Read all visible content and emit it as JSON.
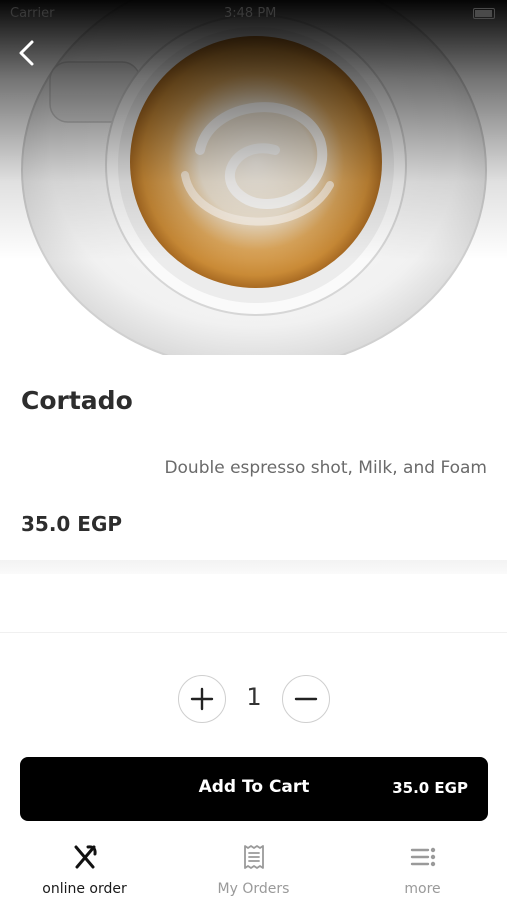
{
  "status_bar": {
    "carrier": "Carrier",
    "time": "3:48 PM"
  },
  "product": {
    "name": "Cortado",
    "description": "Double espresso shot, Milk, and Foam",
    "price": "35.0 EGP"
  },
  "quantity": {
    "value": "1"
  },
  "cart": {
    "label": "Add To Cart",
    "price": "35.0 EGP"
  },
  "tabs": [
    {
      "label": "online order",
      "icon": "fork-knife-icon",
      "active": true
    },
    {
      "label": "My Orders",
      "icon": "receipt-icon",
      "active": false
    },
    {
      "label": "more",
      "icon": "more-list-icon",
      "active": false
    }
  ],
  "colors": {
    "primary": "#000000",
    "inactive": "#9a9a9a"
  }
}
